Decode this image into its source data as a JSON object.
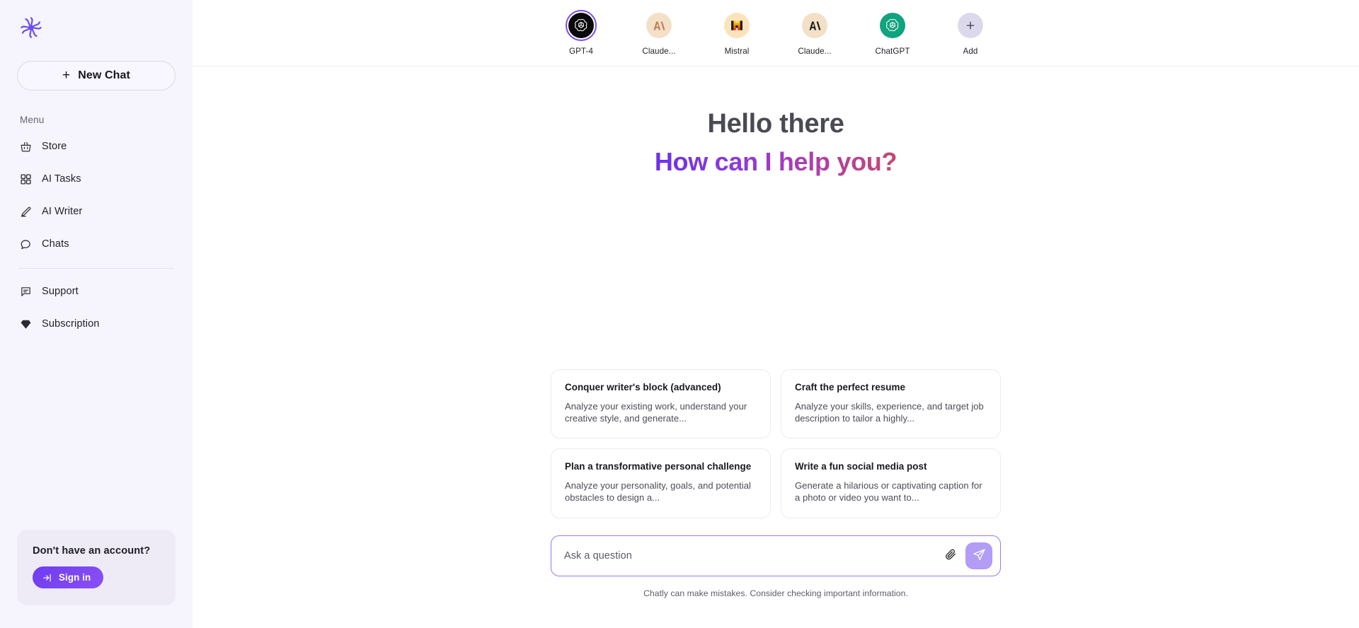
{
  "app": {
    "name": "Chatly"
  },
  "brand": {
    "accent": "#7c4ded",
    "accent_dark": "#6d3cf0",
    "sidebar_bg": "#f6f4fd"
  },
  "sidebar": {
    "logo_icon": "chatly-spiral-logo",
    "new_chat_label": "New Chat",
    "new_chat_icon": "plus-icon",
    "menu_label": "Menu",
    "items": [
      {
        "label": "Store",
        "icon": "basket-icon"
      },
      {
        "label": "AI Tasks",
        "icon": "grid-icon"
      },
      {
        "label": "AI Writer",
        "icon": "pencil-icon"
      },
      {
        "label": "Chats",
        "icon": "chat-bubble-icon"
      }
    ],
    "secondary_items": [
      {
        "label": "Support",
        "icon": "message-square-icon"
      },
      {
        "label": "Subscription",
        "icon": "diamond-icon"
      }
    ],
    "account_card": {
      "title": "Don't have an account?",
      "button_label": "Sign in",
      "button_icon": "login-arrow-icon"
    }
  },
  "model_bar": {
    "models": [
      {
        "label": "GPT-4",
        "icon": "openai-icon",
        "active": true
      },
      {
        "label": "Claude...",
        "icon": "anthropic-icon",
        "active": false
      },
      {
        "label": "Mistral",
        "icon": "mistral-icon",
        "active": false
      },
      {
        "label": "Claude...",
        "icon": "anthropic-icon",
        "active": false
      },
      {
        "label": "ChatGPT",
        "icon": "openai-green-icon",
        "active": false
      },
      {
        "label": "Add",
        "icon": "plus-icon",
        "active": false
      }
    ]
  },
  "main": {
    "greeting_line1": "Hello there",
    "greeting_line2": "How can I help you?",
    "suggestions": [
      {
        "title": "Conquer writer's block (advanced)",
        "description": "Analyze your existing work, understand your creative style, and generate..."
      },
      {
        "title": "Craft the perfect resume",
        "description": "Analyze your skills, experience, and target job description to tailor a highly..."
      },
      {
        "title": "Plan a transformative personal challenge",
        "description": "Analyze your personality, goals, and potential obstacles to design a..."
      },
      {
        "title": "Write a fun social media post",
        "description": "Generate a hilarious or captivating caption for a photo or video you want to..."
      }
    ],
    "composer": {
      "placeholder": "Ask a question",
      "value": "",
      "attach_icon": "paperclip-icon",
      "send_icon": "send-icon"
    },
    "disclaimer": "Chatly can make mistakes. Consider checking important information."
  }
}
